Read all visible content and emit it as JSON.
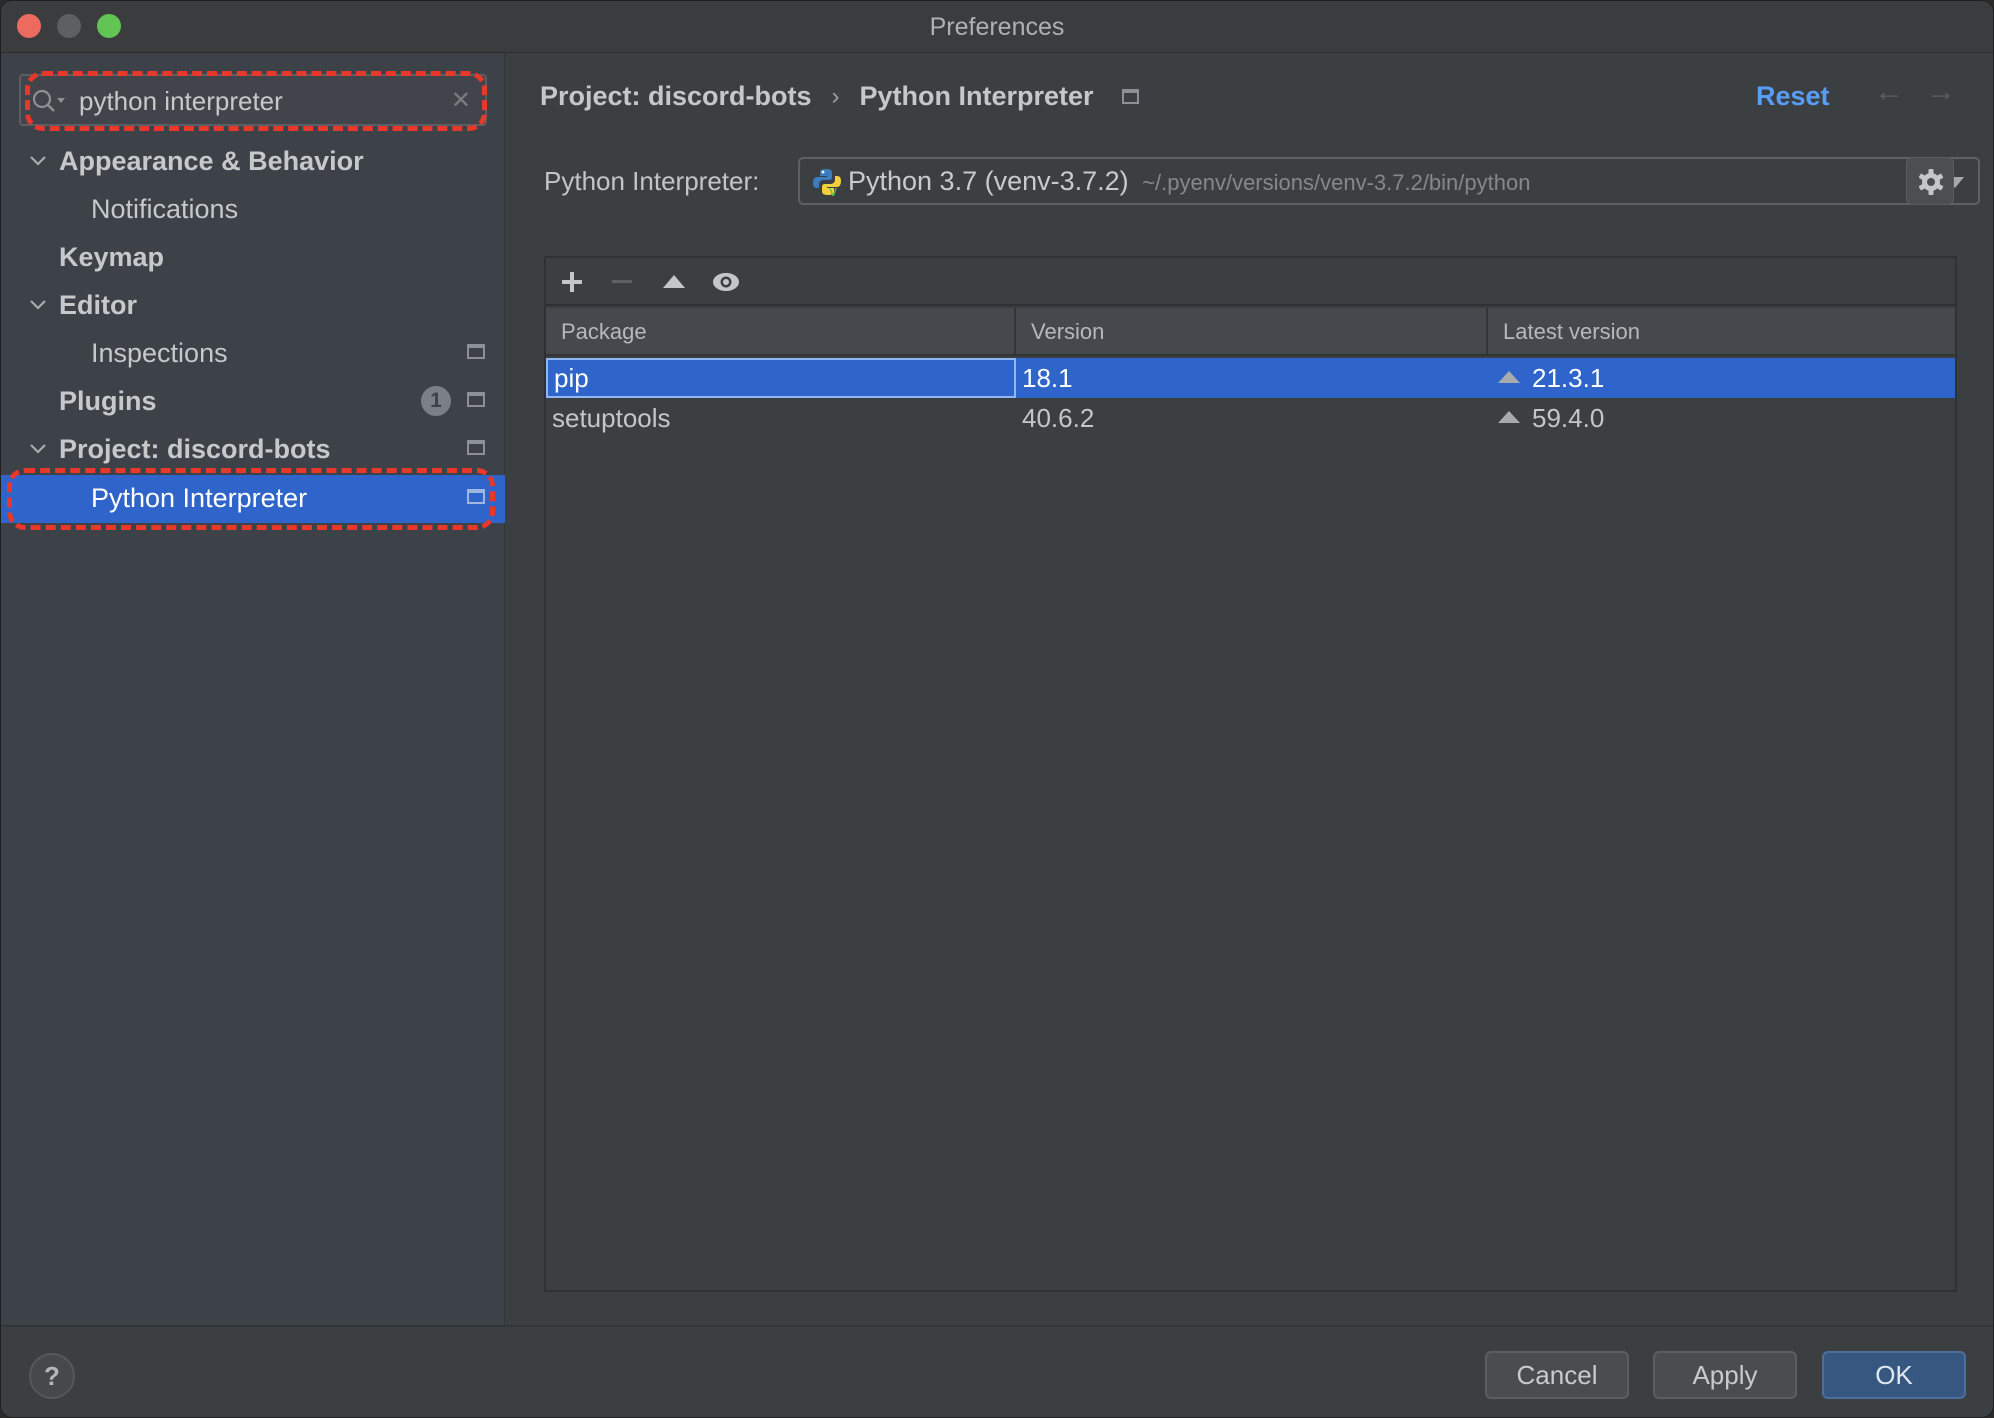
{
  "window": {
    "title": "Preferences"
  },
  "sidebar": {
    "search": {
      "value": "python interpreter",
      "placeholder": ""
    },
    "items": [
      {
        "label": "Appearance & Behavior",
        "expanded": true,
        "level": 0
      },
      {
        "label": "Notifications",
        "level": 1
      },
      {
        "label": "Keymap",
        "level": 0
      },
      {
        "label": "Editor",
        "expanded": true,
        "level": 0
      },
      {
        "label": "Inspections",
        "level": 1
      },
      {
        "label": "Plugins",
        "level": 0,
        "badge": "1"
      },
      {
        "label": "Project: discord-bots",
        "expanded": true,
        "level": 0
      },
      {
        "label": "Python Interpreter",
        "level": 1,
        "selected": true
      }
    ]
  },
  "content": {
    "breadcrumb": {
      "parent": "Project: discord-bots",
      "separator": "›",
      "current": "Python Interpreter"
    },
    "reset_label": "Reset",
    "back_arrow": "←",
    "forward_arrow": "→",
    "interpreter": {
      "label": "Python Interpreter:",
      "name": "Python 3.7 (venv-3.7.2)",
      "path": "~/.pyenv/versions/venv-3.7.2/bin/python"
    },
    "toolbar": {
      "add": "+",
      "remove": "−",
      "upgrade": "▲",
      "show_early_releases": "eye"
    },
    "table": {
      "columns": [
        "Package",
        "Version",
        "Latest version"
      ],
      "rows": [
        {
          "package": "pip",
          "version": "18.1",
          "latest": "21.3.1",
          "selected": true
        },
        {
          "package": "setuptools",
          "version": "40.6.2",
          "latest": "59.4.0",
          "selected": false
        }
      ]
    }
  },
  "footer": {
    "help": "?",
    "cancel": "Cancel",
    "apply": "Apply",
    "ok": "OK"
  },
  "colors": {
    "selection": "#2f65ca",
    "link": "#589df6",
    "annotation": "#e8372b",
    "primary_button": "#365880"
  }
}
